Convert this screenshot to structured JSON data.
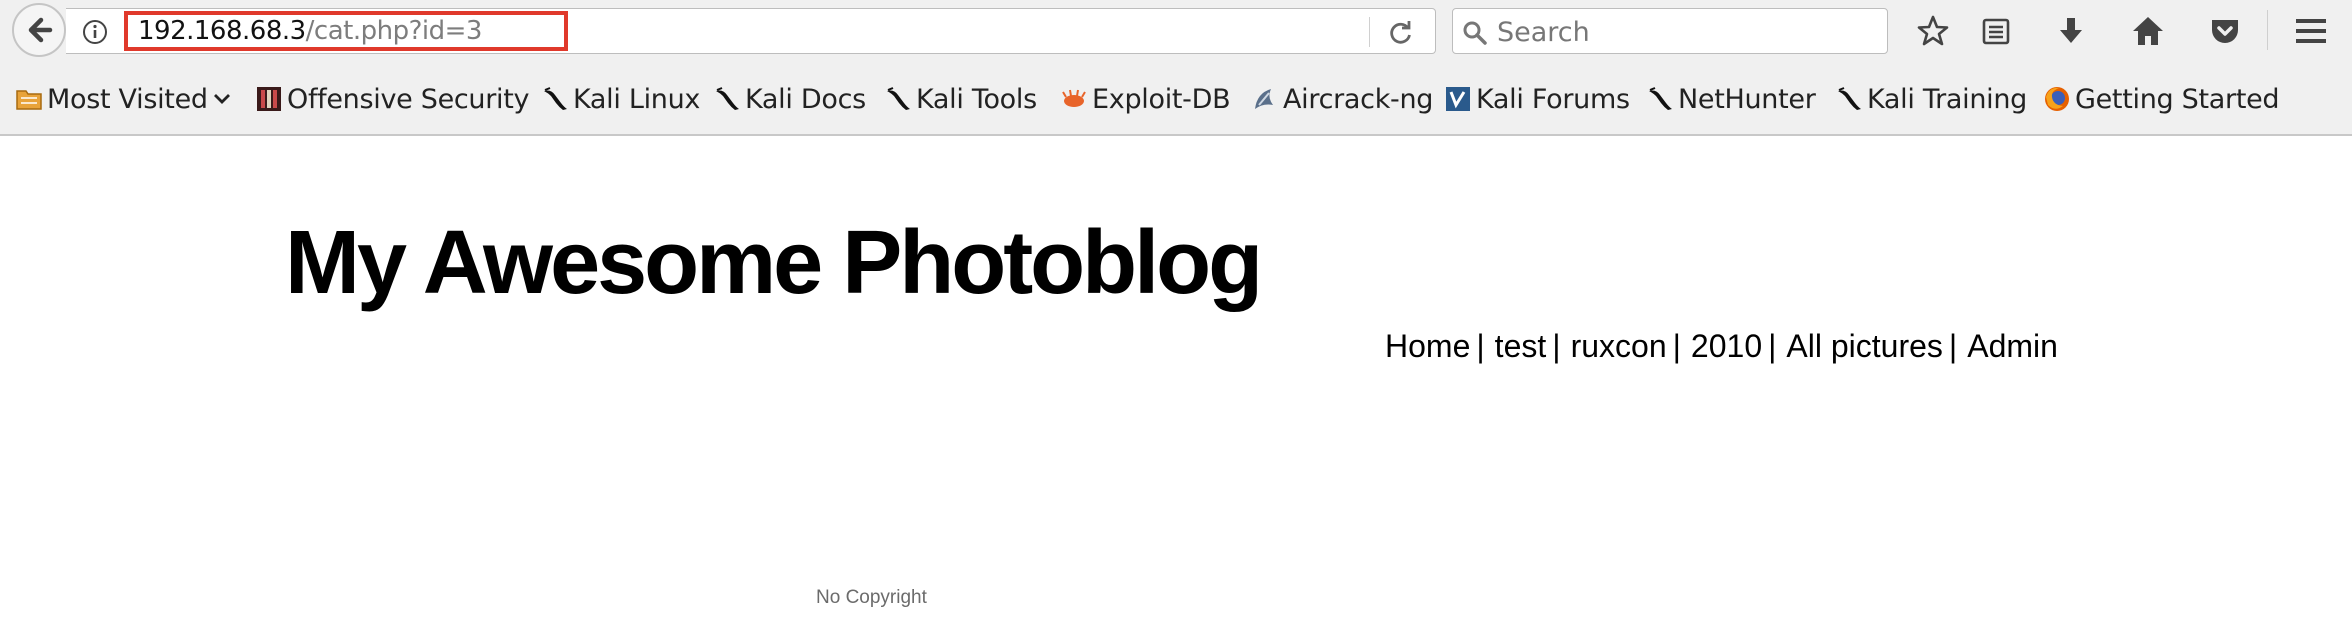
{
  "browser": {
    "url_host": "192.168.68.3",
    "url_path": "/cat.php?id=3",
    "search_placeholder": "Search",
    "highlight_color": "#e0392b"
  },
  "bookmarks": [
    {
      "label": "Most Visited",
      "icon": "folder-icon"
    },
    {
      "label": "Offensive Security",
      "icon": "offsec-icon"
    },
    {
      "label": "Kali Linux",
      "icon": "kali-dragon-icon"
    },
    {
      "label": "Kali Docs",
      "icon": "kali-dragon-icon"
    },
    {
      "label": "Kali Tools",
      "icon": "kali-dragon-icon"
    },
    {
      "label": "Exploit-DB",
      "icon": "exploitdb-icon"
    },
    {
      "label": "Aircrack-ng",
      "icon": "aircrack-icon"
    },
    {
      "label": "Kali Forums",
      "icon": "kali-forums-icon"
    },
    {
      "label": "NetHunter",
      "icon": "kali-dragon-icon"
    },
    {
      "label": "Kali Training",
      "icon": "kali-dragon-icon"
    },
    {
      "label": "Getting Started",
      "icon": "firefox-icon"
    }
  ],
  "page": {
    "title": "My Awesome Photoblog",
    "nav": [
      "Home",
      "test",
      "ruxcon",
      "2010",
      "All pictures",
      "Admin"
    ],
    "nav_separator": "|",
    "footer": "No Copyright"
  }
}
